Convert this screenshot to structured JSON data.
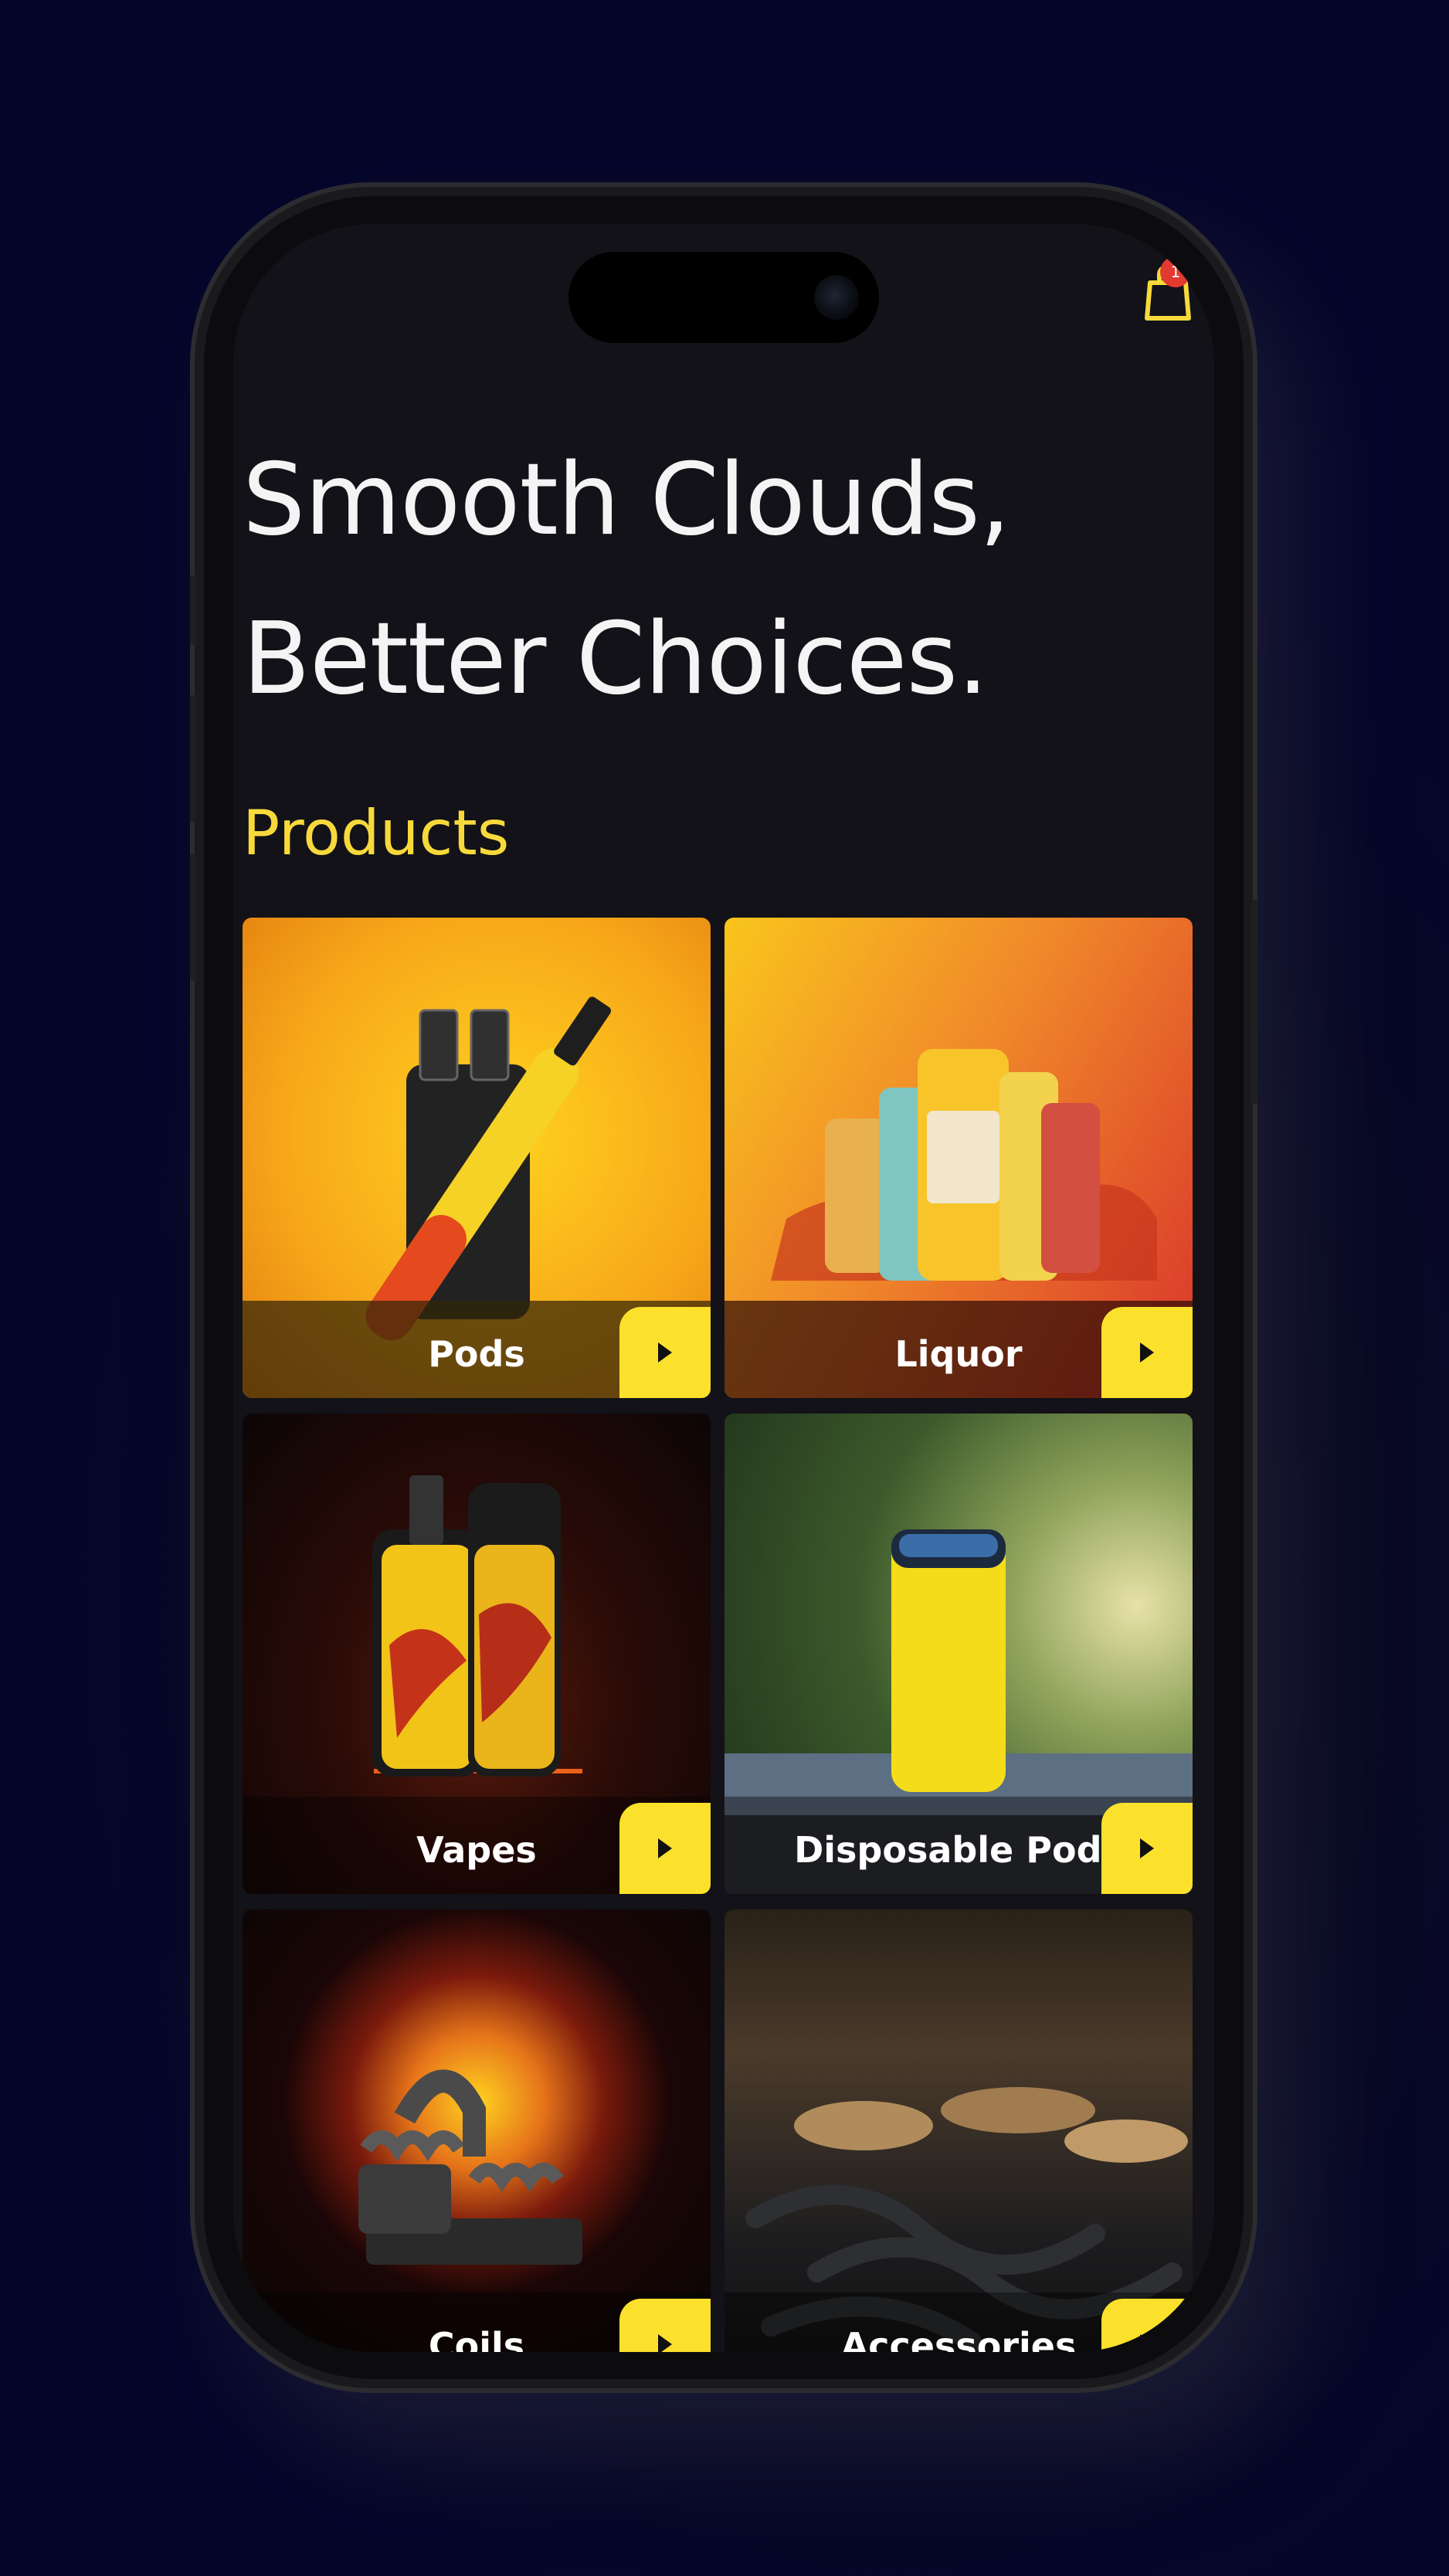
{
  "app": {
    "cart": {
      "icon": "shopping-bag-icon",
      "badge_count": "1"
    },
    "headline": {
      "line1": "Smooth Clouds,",
      "line2": "Better Choices."
    },
    "section_title": "Products",
    "products": [
      {
        "label": "Pods",
        "icon": "play-arrow-icon"
      },
      {
        "label": "Liquor",
        "icon": "play-arrow-icon"
      },
      {
        "label": "Vapes",
        "icon": "play-arrow-icon"
      },
      {
        "label": "Disposable Pods",
        "icon": "play-arrow-icon"
      },
      {
        "label": "Coils",
        "icon": "play-arrow-icon"
      },
      {
        "label": "Accessories",
        "icon": "play-arrow-icon"
      }
    ]
  },
  "colors": {
    "background": "#05062a",
    "screen": "#121218",
    "accent_yellow": "#fbe12b",
    "headline_text": "#f4f4f4",
    "section_title": "#f7d93b",
    "badge": "#e23a2f"
  }
}
